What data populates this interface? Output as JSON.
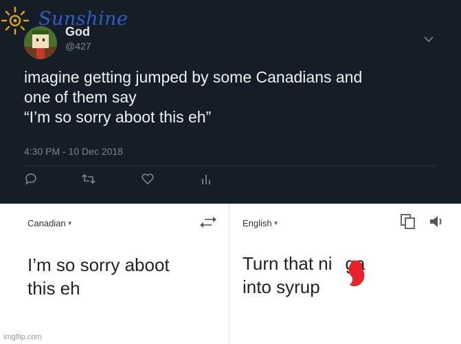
{
  "watermark": {
    "text": "Sunshine"
  },
  "tweet": {
    "name": "God",
    "handle": "@427",
    "lines": [
      "imagine getting jumped by some Canadians and",
      "one of them say",
      "“I’m so sorry aboot this eh”"
    ],
    "timestamp": "4:30 PM - 10 Dec 2018",
    "icons": [
      "chevron-down-icon",
      "reply-icon",
      "retweet-icon",
      "like-icon",
      "analytics-icon"
    ]
  },
  "translate": {
    "source_lang": "Canadian",
    "target_lang": "English",
    "source_lines": [
      "I’m so sorry aboot",
      "this eh"
    ],
    "target_lines": [
      "Turn that ni",
      "ga",
      "into syrup"
    ],
    "icons": [
      "swap-icon",
      "copy-icon",
      "speaker-icon"
    ]
  },
  "credit": "imgflip.com",
  "colors": {
    "tweet_bg": "#151d27",
    "watermark": "#2f5fc4",
    "redaction": "#e8202a"
  }
}
